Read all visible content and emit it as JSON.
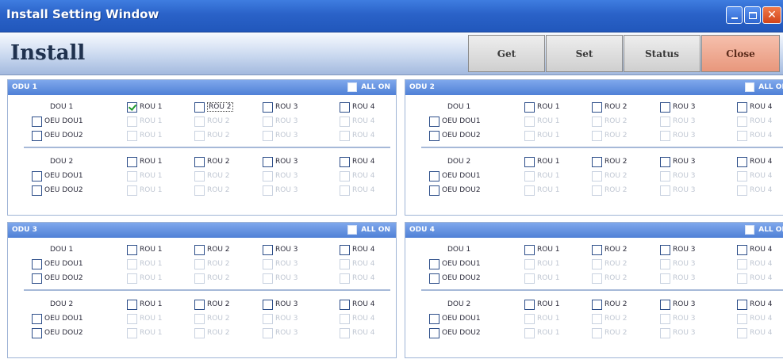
{
  "window": {
    "title": "Install Setting Window",
    "controls": [
      "minimize-icon",
      "maximize-icon",
      "close-icon"
    ]
  },
  "header": {
    "title": "Install",
    "buttons": {
      "get": "Get",
      "set": "Set",
      "status": "Status",
      "close": "Close"
    }
  },
  "colors": {
    "titlebar": "#2a62c8",
    "panel_header": "#4f80d6",
    "close_button": "#e8977c",
    "check": "#1d9a2a"
  },
  "odus": [
    {
      "name": "ODU 1",
      "all_on": "ALL ON",
      "dous": [
        {
          "label": "DOU 1",
          "rows": [
            "OEU DOU1",
            "OEU DOU2"
          ],
          "rous": [
            {
              "label": "ROU 1",
              "checked": true
            },
            {
              "label": "ROU 2",
              "checked": false
            },
            {
              "label": "ROU 3",
              "checked": false
            },
            {
              "label": "ROU 4",
              "checked": false
            }
          ],
          "sub": [
            "ROU 1",
            "ROU 2",
            "ROU 3",
            "ROU 4"
          ]
        },
        {
          "label": "DOU 2",
          "rows": [
            "OEU DOU1",
            "OEU DOU2"
          ],
          "rous": [
            {
              "label": "ROU 1",
              "checked": false
            },
            {
              "label": "ROU 2",
              "checked": false
            },
            {
              "label": "ROU 3",
              "checked": false
            },
            {
              "label": "ROU 4",
              "checked": false
            }
          ],
          "sub": [
            "ROU 1",
            "ROU 2",
            "ROU 3",
            "ROU 4"
          ]
        }
      ]
    },
    {
      "name": "ODU 2",
      "all_on": "ALL ON",
      "dous": [
        {
          "label": "DOU 1",
          "rows": [
            "OEU DOU1",
            "OEU DOU2"
          ],
          "rous": [
            {
              "label": "ROU 1",
              "checked": false
            },
            {
              "label": "ROU 2",
              "checked": false
            },
            {
              "label": "ROU 3",
              "checked": false
            },
            {
              "label": "ROU 4",
              "checked": false
            }
          ],
          "sub": [
            "ROU 1",
            "ROU 2",
            "ROU 3",
            "ROU 4"
          ]
        },
        {
          "label": "DOU 2",
          "rows": [
            "OEU DOU1",
            "OEU DOU2"
          ],
          "rous": [
            {
              "label": "ROU 1",
              "checked": false
            },
            {
              "label": "ROU 2",
              "checked": false
            },
            {
              "label": "ROU 3",
              "checked": false
            },
            {
              "label": "ROU 4",
              "checked": false
            }
          ],
          "sub": [
            "ROU 1",
            "ROU 2",
            "ROU 3",
            "ROU 4"
          ]
        }
      ]
    },
    {
      "name": "ODU 3",
      "all_on": "ALL ON",
      "dous": [
        {
          "label": "DOU 1",
          "rows": [
            "OEU DOU1",
            "OEU DOU2"
          ],
          "rous": [
            {
              "label": "ROU 1",
              "checked": false
            },
            {
              "label": "ROU 2",
              "checked": false
            },
            {
              "label": "ROU 3",
              "checked": false
            },
            {
              "label": "ROU 4",
              "checked": false
            }
          ],
          "sub": [
            "ROU 1",
            "ROU 2",
            "ROU 3",
            "ROU 4"
          ]
        },
        {
          "label": "DOU 2",
          "rows": [
            "OEU DOU1",
            "OEU DOU2"
          ],
          "rous": [
            {
              "label": "ROU 1",
              "checked": false
            },
            {
              "label": "ROU 2",
              "checked": false
            },
            {
              "label": "ROU 3",
              "checked": false
            },
            {
              "label": "ROU 4",
              "checked": false
            }
          ],
          "sub": [
            "ROU 1",
            "ROU 2",
            "ROU 3",
            "ROU 4"
          ]
        }
      ]
    },
    {
      "name": "ODU 4",
      "all_on": "ALL ON",
      "dous": [
        {
          "label": "DOU 1",
          "rows": [
            "OEU DOU1",
            "OEU DOU2"
          ],
          "rous": [
            {
              "label": "ROU 1",
              "checked": false
            },
            {
              "label": "ROU 2",
              "checked": false
            },
            {
              "label": "ROU 3",
              "checked": false
            },
            {
              "label": "ROU 4",
              "checked": false
            }
          ],
          "sub": [
            "ROU 1",
            "ROU 2",
            "ROU 3",
            "ROU 4"
          ]
        },
        {
          "label": "DOU 2",
          "rows": [
            "OEU DOU1",
            "OEU DOU2"
          ],
          "rous": [
            {
              "label": "ROU 1",
              "checked": false
            },
            {
              "label": "ROU 2",
              "checked": false
            },
            {
              "label": "ROU 3",
              "checked": false
            },
            {
              "label": "ROU 4",
              "checked": false
            }
          ],
          "sub": [
            "ROU 1",
            "ROU 2",
            "ROU 3",
            "ROU 4"
          ]
        }
      ]
    }
  ]
}
